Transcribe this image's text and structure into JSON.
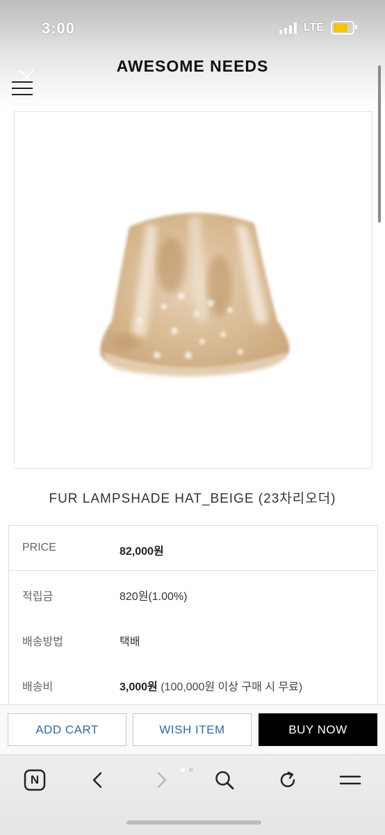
{
  "status_bar": {
    "time": "3:00",
    "network": "LTE"
  },
  "header": {
    "brand": "AWESOME NEEDS"
  },
  "product": {
    "title": "FUR LAMPSHADE HAT_BEIGE (23차리오더)",
    "image_alt": "fur bucket hat"
  },
  "info": {
    "price_label": "PRICE",
    "price_value": "82,000원",
    "points_label": "적립금",
    "points_value": "820원(1.00%)",
    "shipping_method_label": "배송방법",
    "shipping_method_value": "택배",
    "shipping_fee_label": "배송비",
    "shipping_fee_value": "3,000원",
    "shipping_fee_note": "(100,000원 이상 구매 시 무료)"
  },
  "actions": {
    "add_cart": "ADD CART",
    "wish_item": "WISH ITEM",
    "buy_now": "BUY NOW"
  },
  "browser": {
    "naver_badge": "N"
  },
  "colors": {
    "accent_link": "#2b6cb0",
    "buy_button": "#000000",
    "hat_base": "#d9bd9a"
  }
}
